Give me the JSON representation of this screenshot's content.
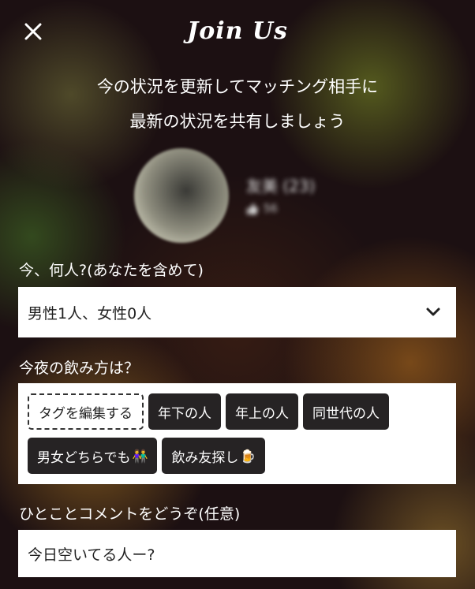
{
  "header": {
    "title": "Join Us",
    "close_icon": "close-icon"
  },
  "subtitle": {
    "line1": "今の状況を更新してマッチング相手に",
    "line2": "最新の状況を共有しましょう"
  },
  "profile": {
    "name": "友美 (23)",
    "meta": "56"
  },
  "people": {
    "label": "今、何人?(あなたを含めて)",
    "selected": "男性1人、女性0人",
    "dropdown_icon": "chevron-down-icon"
  },
  "style": {
    "label": "今夜の飲み方は？",
    "edit_tag": "タグを編集する",
    "tags": [
      "年下の人",
      "年上の人",
      "同世代の人",
      "男女どちらでも",
      "飲み友探し"
    ],
    "tag_emojis": [
      "👫",
      "🍺"
    ]
  },
  "comment": {
    "label": "ひとことコメントをどうぞ(任意)",
    "value": "今日空いてる人ー?"
  },
  "colors": {
    "tag_bg": "#262324",
    "panel_bg": "#ffffff",
    "text_light": "#ffffff"
  }
}
